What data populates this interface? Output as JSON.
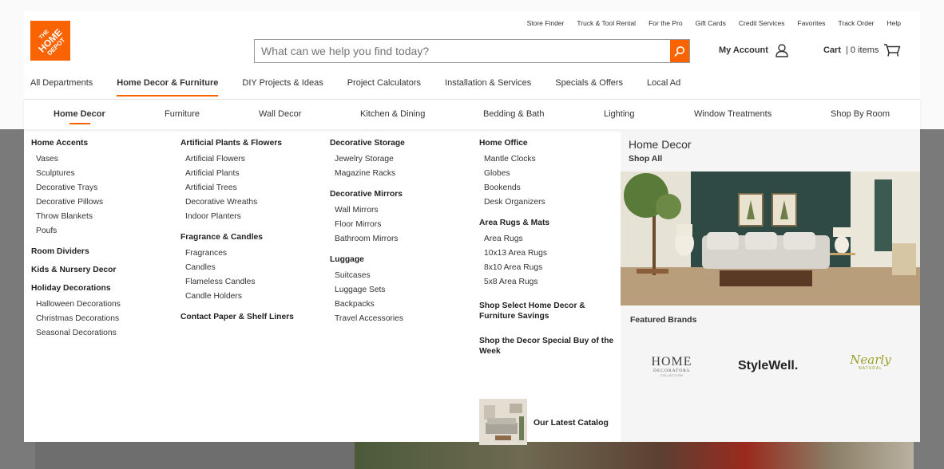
{
  "colors": {
    "brand_orange": "#f96302",
    "text": "#333333",
    "overlay": "#7a7a7a"
  },
  "logo": {
    "line1": "THE",
    "line2": "HOME",
    "line3": "DEPOT"
  },
  "utility": [
    "Store Finder",
    "Truck & Tool Rental",
    "For the Pro",
    "Gift Cards",
    "Credit Services",
    "Favorites",
    "Track Order",
    "Help"
  ],
  "search": {
    "placeholder": "What can we help you find today?",
    "icon": "search-icon"
  },
  "account": {
    "label": "My Account",
    "icon": "person-icon"
  },
  "cart": {
    "label": "Cart",
    "count": "| 0 items",
    "icon": "cart-icon"
  },
  "nav_primary": [
    "All Departments",
    "Home Decor & Furniture",
    "DIY Projects & Ideas",
    "Project Calculators",
    "Installation & Services",
    "Specials & Offers",
    "Local Ad"
  ],
  "nav_secondary": [
    "Home Decor",
    "Furniture",
    "Wall Decor",
    "Kitchen & Dining",
    "Bedding & Bath",
    "Lighting",
    "Window Treatments",
    "Shop By Room"
  ],
  "menu": {
    "col1": {
      "home_accents": {
        "title": "Home Accents",
        "links": [
          "Vases",
          "Sculptures",
          "Decorative Trays",
          "Decorative Pillows",
          "Throw Blankets",
          "Poufs"
        ]
      },
      "room_dividers": "Room Dividers",
      "kids": "Kids & Nursery Decor",
      "holiday": {
        "title": "Holiday Decorations",
        "links": [
          "Halloween Decorations",
          "Christmas Decorations",
          "Seasonal Decorations"
        ]
      }
    },
    "col2": {
      "plants": {
        "title": "Artificial Plants & Flowers",
        "links": [
          "Artificial Flowers",
          "Artificial Plants",
          "Artificial Trees",
          "Decorative Wreaths",
          "Indoor Planters"
        ]
      },
      "fragrance": {
        "title": "Fragrance & Candles",
        "links": [
          "Fragrances",
          "Candles",
          "Flameless Candles",
          "Candle Holders"
        ]
      },
      "contact_paper": "Contact Paper & Shelf Liners"
    },
    "col3": {
      "storage": {
        "title": "Decorative Storage",
        "links": [
          "Jewelry Storage",
          "Magazine Racks"
        ]
      },
      "mirrors": {
        "title": "Decorative Mirrors",
        "links": [
          "Wall Mirrors",
          "Floor Mirrors",
          "Bathroom Mirrors"
        ]
      },
      "luggage": {
        "title": "Luggage",
        "links": [
          "Suitcases",
          "Luggage Sets",
          "Backpacks",
          "Travel Accessories"
        ]
      }
    },
    "col4": {
      "office": {
        "title": "Home Office",
        "links": [
          "Mantle Clocks",
          "Globes",
          "Bookends",
          "Desk Organizers"
        ]
      },
      "rugs": {
        "title": "Area Rugs & Mats",
        "links": [
          "Area Rugs",
          "10x13 Area Rugs",
          "8x10 Area Rugs",
          "5x8 Area Rugs"
        ]
      },
      "savings": "Shop Select Home Decor & Furniture Savings",
      "special_buy": "Shop the Decor Special Buy of the Week",
      "catalog": "Our Latest Catalog"
    }
  },
  "feature": {
    "title": "Home Decor",
    "shop_all": "Shop All",
    "brands_label": "Featured Brands",
    "brands": {
      "home_dec_1": "HOME",
      "home_dec_2": "DECORATORS",
      "home_dec_3": "COLLECTION",
      "stylewell": "StyleWell.",
      "nearly_1": "Nearly",
      "nearly_2": "NATURAL"
    }
  }
}
